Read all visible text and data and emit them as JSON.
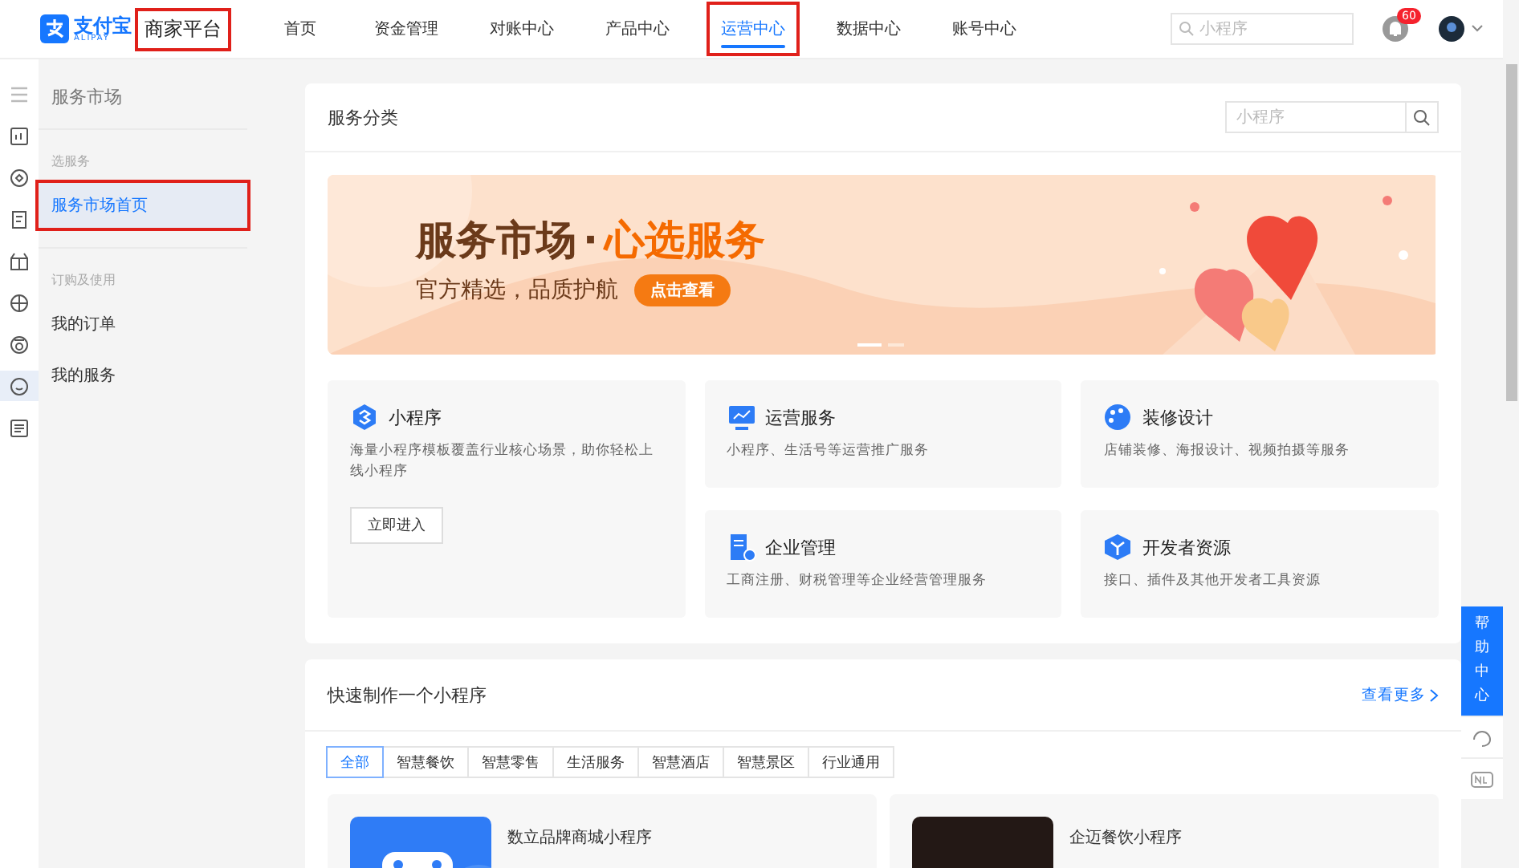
{
  "header": {
    "logo_text": "支付宝",
    "logo_subtext": "ALIPAY",
    "platform": "商家平台",
    "platform_annotated": true,
    "nav": [
      {
        "label": "首页",
        "selected": false,
        "annotated": false
      },
      {
        "label": "资金管理",
        "selected": false,
        "annotated": false
      },
      {
        "label": "对账中心",
        "selected": false,
        "annotated": false
      },
      {
        "label": "产品中心",
        "selected": false,
        "annotated": false
      },
      {
        "label": "运营中心",
        "selected": true,
        "annotated": true
      },
      {
        "label": "数据中心",
        "selected": false,
        "annotated": false
      },
      {
        "label": "账号中心",
        "selected": false,
        "annotated": false
      }
    ],
    "search": {
      "placeholder": "小程序"
    },
    "notification_count": "60"
  },
  "rail": {
    "items": [
      {
        "selected": false
      },
      {
        "selected": false
      },
      {
        "selected": false
      },
      {
        "selected": false
      },
      {
        "selected": false
      },
      {
        "selected": false
      },
      {
        "selected": false
      },
      {
        "selected": true
      },
      {
        "selected": false
      }
    ]
  },
  "sidebar": {
    "title": "服务市场",
    "groups": [
      {
        "label": "选服务",
        "items": [
          {
            "label": "服务市场首页",
            "selected": true,
            "annotated": true
          }
        ]
      },
      {
        "label": "订购及使用",
        "items": [
          {
            "label": "我的订单",
            "selected": false,
            "annotated": false
          },
          {
            "label": "我的服务",
            "selected": false,
            "annotated": false
          }
        ]
      }
    ]
  },
  "categories": {
    "title": "服务分类",
    "search": {
      "placeholder": "小程序"
    },
    "banner": {
      "headline": "服务市场",
      "separator": "·",
      "highlight": "心选服务",
      "tagline": "官方精选，品质护航",
      "button": "点击查看",
      "dots": [
        {
          "selected": true
        },
        {
          "selected": false
        }
      ]
    },
    "cards": [
      {
        "title": "小程序",
        "desc": "海量小程序模板覆盖行业核心场景，助你轻松上线小程序",
        "button": "立即进入"
      },
      {
        "title": "运营服务",
        "desc": "小程序、生活号等运营推广服务"
      },
      {
        "title": "装修设计",
        "desc": "店铺装修、海报设计、视频拍摄等服务"
      },
      {
        "title": "企业管理",
        "desc": "工商注册、财税管理等企业经营管理服务"
      },
      {
        "title": "开发者资源",
        "desc": "接口、插件及其他开发者工具资源"
      }
    ]
  },
  "quick": {
    "title": "快速制作一个小程序",
    "more": "查看更多",
    "tabs": [
      {
        "label": "全部",
        "selected": true
      },
      {
        "label": "智慧餐饮",
        "selected": false
      },
      {
        "label": "智慧零售",
        "selected": false
      },
      {
        "label": "生活服务",
        "selected": false
      },
      {
        "label": "智慧酒店",
        "selected": false
      },
      {
        "label": "智慧景区",
        "selected": false
      },
      {
        "label": "行业通用",
        "selected": false
      }
    ],
    "products": [
      {
        "name": "数立品牌商城小程序"
      },
      {
        "name": "企迈餐饮小程序"
      }
    ]
  },
  "help": {
    "label": "帮助中心"
  }
}
